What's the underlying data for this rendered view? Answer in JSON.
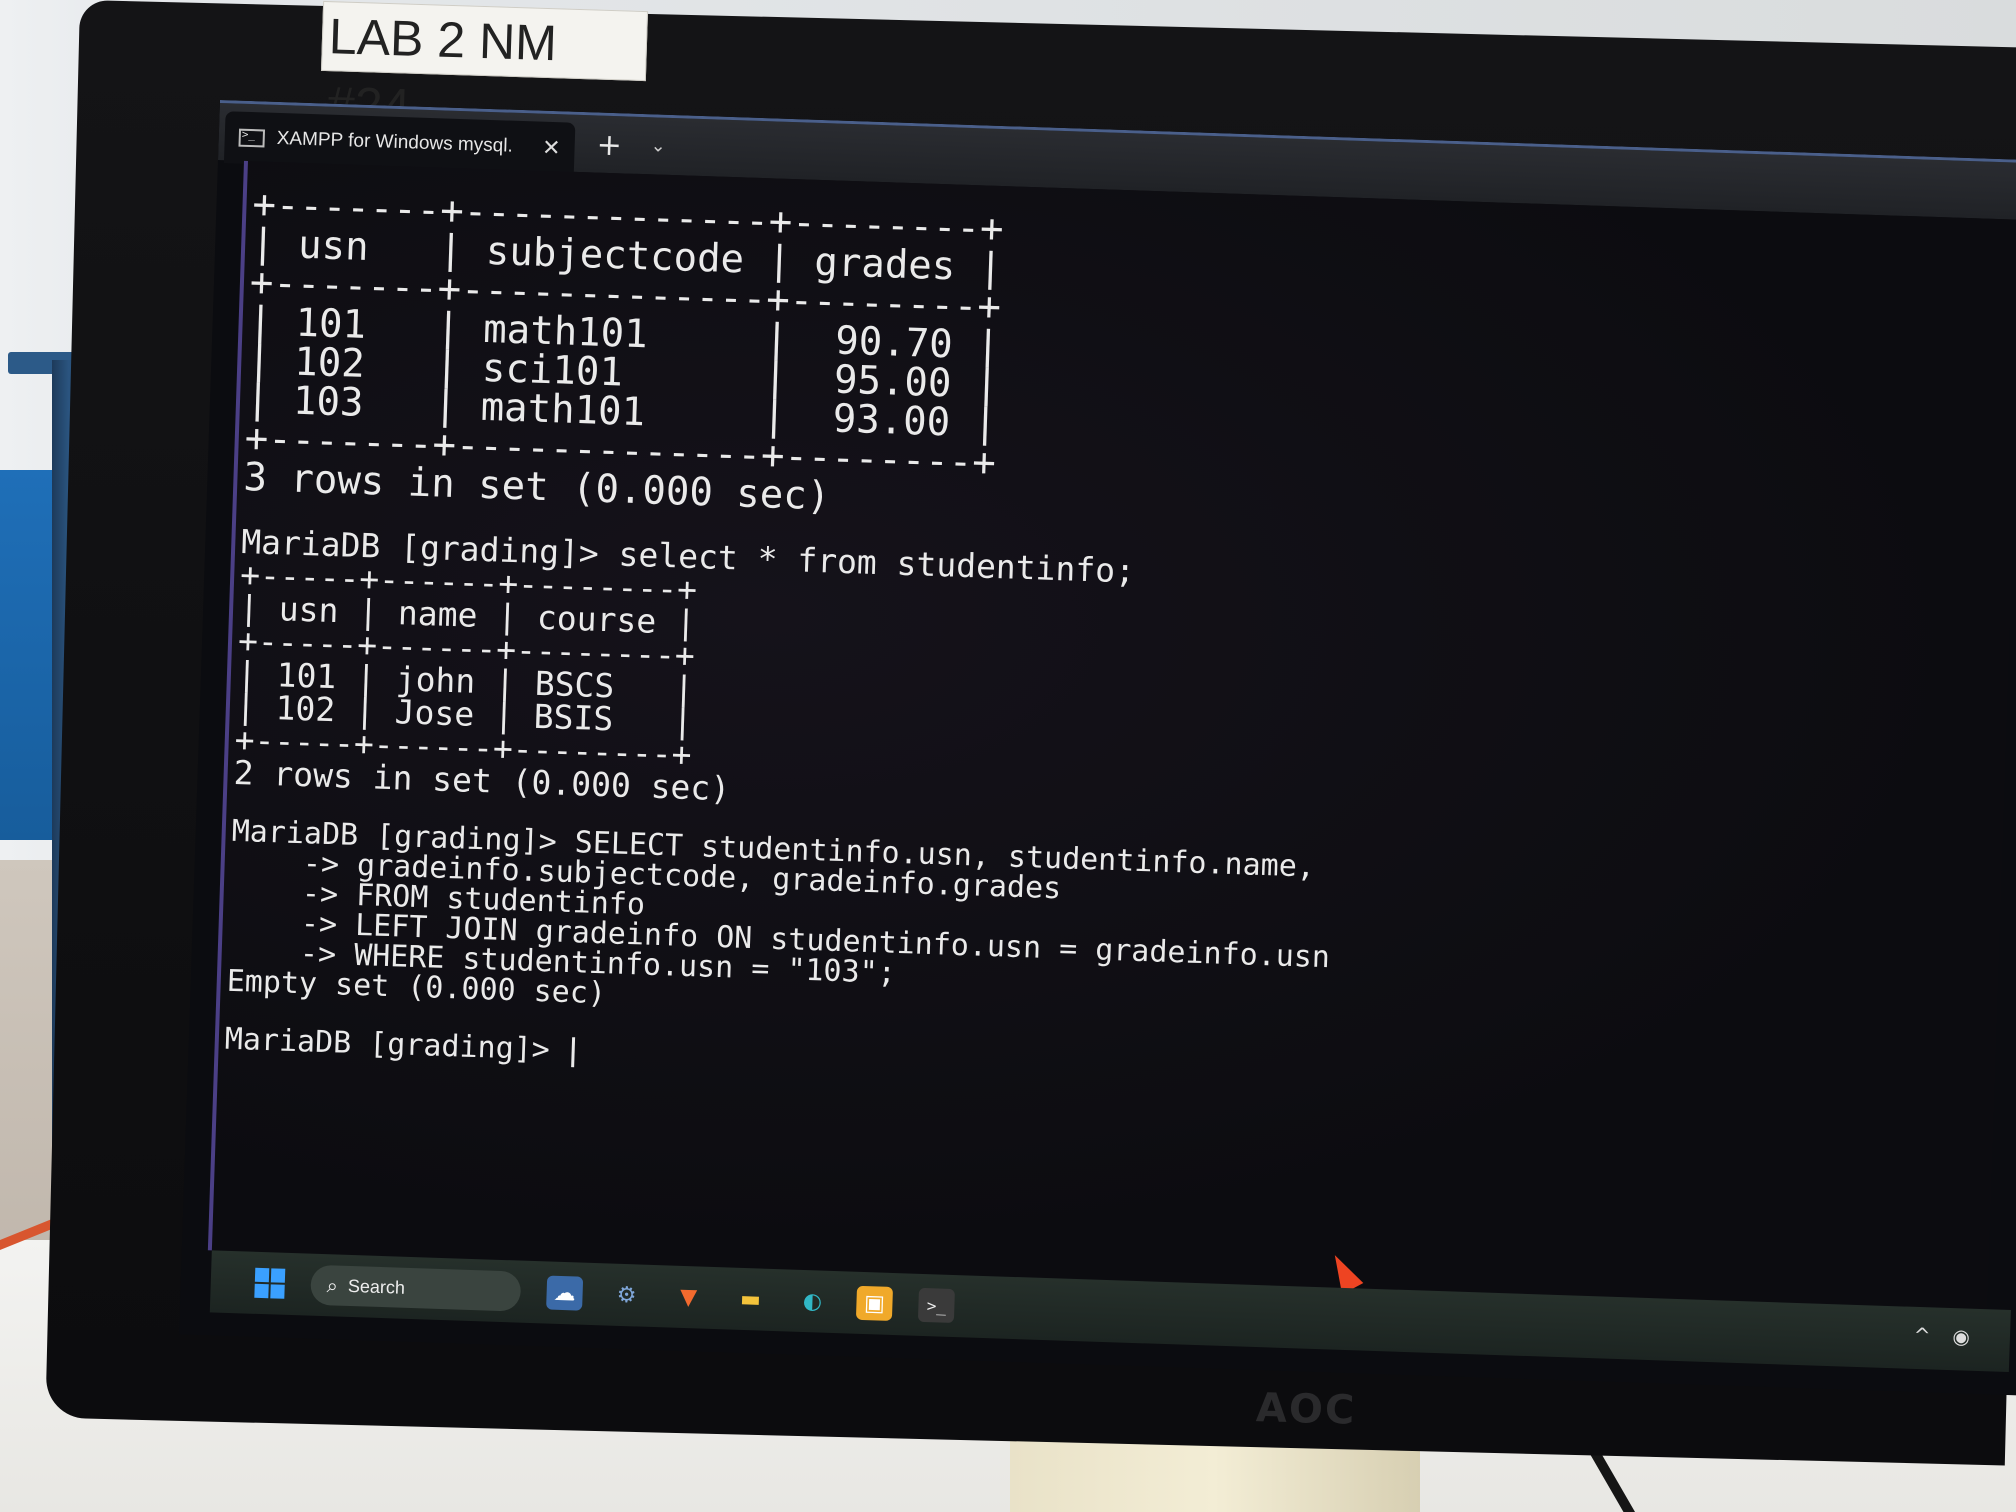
{
  "sticker": {
    "text": "LAB 2 NM #24"
  },
  "brand": {
    "text": "AOC"
  },
  "window": {
    "tab_label": "XAMPP for Windows   mysql.",
    "close_glyph": "✕",
    "new_tab_glyph": "+",
    "dropdown_glyph": "⌄"
  },
  "terminal": {
    "lines_table1": [
      "+-------+-------------+--------+",
      "| usn   | subjectcode | grades |",
      "+-------+-------------+--------+",
      "| 101   | math101     |  90.70 |",
      "| 102   | sci101      |  95.00 |",
      "| 103   | math101     |  93.00 |",
      "+-------+-------------+--------+",
      "3 rows in set (0.000 sec)"
    ],
    "lines_table2": [
      "MariaDB [grading]> select * from studentinfo;",
      "+-----+------+--------+",
      "| usn | name | course |",
      "+-----+------+--------+",
      "| 101 | john | BSCS   |",
      "| 102 | Jose | BSIS   |",
      "+-----+------+--------+",
      "2 rows in set (0.000 sec)"
    ],
    "lines_query": [
      "MariaDB [grading]> SELECT studentinfo.usn, studentinfo.name,",
      "    -> gradeinfo.subjectcode, gradeinfo.grades",
      "    -> FROM studentinfo",
      "    -> LEFT JOIN gradeinfo ON studentinfo.usn = gradeinfo.usn",
      "    -> WHERE studentinfo.usn = \"103\";",
      "Empty set (0.000 sec)"
    ],
    "prompt": "MariaDB [grading]> "
  },
  "taskbar": {
    "search_label": "Search",
    "icons": [
      "widgets-icon",
      "settings-icon",
      "brave-browser-icon",
      "file-explorer-icon",
      "edge-browser-icon",
      "photos-icon",
      "terminal-icon"
    ],
    "tray_chevron": "^"
  },
  "colors": {
    "terminal_bg": "#0c0c10",
    "terminal_text": "#eaeaea",
    "accent_border": "#4b3f86",
    "pointer": "#ee4422"
  }
}
